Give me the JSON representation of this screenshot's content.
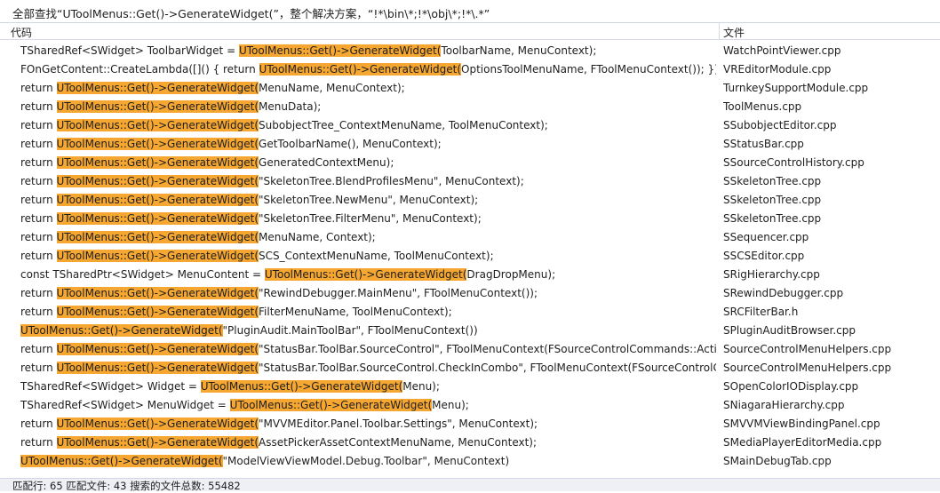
{
  "title": "全部查找“UToolMenus::Get()->GenerateWidget(”，整个解决方案，“!*\\bin\\*;!*\\obj\\*;!*\\.*”",
  "columns": {
    "code": "代码",
    "file": "文件"
  },
  "sort_icon": "chevron-up-icon",
  "highlight_color": "#f5a732",
  "rows": [
    {
      "pre": "TSharedRef<SWidget> ToolbarWidget = ",
      "match": "UToolMenus::Get()->GenerateWidget(",
      "post": "ToolbarName, MenuContext);",
      "file": "WatchPointViewer.cpp"
    },
    {
      "pre": "FOnGetContent::CreateLambda([]() { return ",
      "match": "UToolMenus::Get()->GenerateWidget(",
      "post": "OptionsToolMenuName, FToolMenuContext()); }),",
      "file": "VREditorModule.cpp"
    },
    {
      "pre": "return ",
      "match": "UToolMenus::Get()->GenerateWidget(",
      "post": "MenuName, MenuContext);",
      "file": "TurnkeySupportModule.cpp"
    },
    {
      "pre": "return ",
      "match": "UToolMenus::Get()->GenerateWidget(",
      "post": "MenuData);",
      "file": "ToolMenus.cpp"
    },
    {
      "pre": "return ",
      "match": "UToolMenus::Get()->GenerateWidget(",
      "post": "SubobjectTree_ContextMenuName, ToolMenuContext);",
      "file": "SSubobjectEditor.cpp"
    },
    {
      "pre": "return ",
      "match": "UToolMenus::Get()->GenerateWidget(",
      "post": "GetToolbarName(), MenuContext);",
      "file": "SStatusBar.cpp"
    },
    {
      "pre": "return ",
      "match": "UToolMenus::Get()->GenerateWidget(",
      "post": "GeneratedContextMenu);",
      "file": "SSourceControlHistory.cpp"
    },
    {
      "pre": "return ",
      "match": "UToolMenus::Get()->GenerateWidget(",
      "post": "\"SkeletonTree.BlendProfilesMenu\", MenuContext);",
      "file": "SSkeletonTree.cpp"
    },
    {
      "pre": "return ",
      "match": "UToolMenus::Get()->GenerateWidget(",
      "post": "\"SkeletonTree.NewMenu\", MenuContext);",
      "file": "SSkeletonTree.cpp"
    },
    {
      "pre": "return ",
      "match": "UToolMenus::Get()->GenerateWidget(",
      "post": "\"SkeletonTree.FilterMenu\", MenuContext);",
      "file": "SSkeletonTree.cpp"
    },
    {
      "pre": "return ",
      "match": "UToolMenus::Get()->GenerateWidget(",
      "post": "MenuName, Context);",
      "file": "SSequencer.cpp"
    },
    {
      "pre": "return ",
      "match": "UToolMenus::Get()->GenerateWidget(",
      "post": "SCS_ContextMenuName, ToolMenuContext);",
      "file": "SSCSEditor.cpp"
    },
    {
      "pre": "const TSharedPtr<SWidget> MenuContent = ",
      "match": "UToolMenus::Get()->GenerateWidget(",
      "post": "DragDropMenu);",
      "file": "SRigHierarchy.cpp"
    },
    {
      "pre": "return ",
      "match": "UToolMenus::Get()->GenerateWidget(",
      "post": "\"RewindDebugger.MainMenu\", FToolMenuContext());",
      "file": "SRewindDebugger.cpp"
    },
    {
      "pre": "return ",
      "match": "UToolMenus::Get()->GenerateWidget(",
      "post": "FilterMenuName, ToolMenuContext);",
      "file": "SRCFilterBar.h"
    },
    {
      "pre": "",
      "match": "UToolMenus::Get()->GenerateWidget(",
      "post": "\"PluginAudit.MainToolBar\", FToolMenuContext())",
      "file": "SPluginAuditBrowser.cpp"
    },
    {
      "pre": "return ",
      "match": "UToolMenus::Get()->GenerateWidget(",
      "post": "\"StatusBar.ToolBar.SourceControl\", FToolMenuContext(FSourceControlCommands::Action…",
      "file": "SourceControlMenuHelpers.cpp"
    },
    {
      "pre": "return ",
      "match": "UToolMenus::Get()->GenerateWidget(",
      "post": "\"StatusBar.ToolBar.SourceControl.CheckInCombo\", FToolMenuContext(FSourceControlCo…",
      "file": "SourceControlMenuHelpers.cpp"
    },
    {
      "pre": "TSharedRef<SWidget> Widget = ",
      "match": "UToolMenus::Get()->GenerateWidget(",
      "post": "Menu);",
      "file": "SOpenColorIODisplay.cpp"
    },
    {
      "pre": "TSharedRef<SWidget> MenuWidget = ",
      "match": "UToolMenus::Get()->GenerateWidget(",
      "post": "Menu);",
      "file": "SNiagaraHierarchy.cpp"
    },
    {
      "pre": "return ",
      "match": "UToolMenus::Get()->GenerateWidget(",
      "post": "\"MVVMEditor.Panel.Toolbar.Settings\", MenuContext);",
      "file": "SMVVMViewBindingPanel.cpp"
    },
    {
      "pre": "return ",
      "match": "UToolMenus::Get()->GenerateWidget(",
      "post": "AssetPickerAssetContextMenuName, MenuContext);",
      "file": "SMediaPlayerEditorMedia.cpp"
    },
    {
      "pre": "",
      "match": "UToolMenus::Get()->GenerateWidget(",
      "post": "\"ModelViewViewModel.Debug.Toolbar\", MenuContext)",
      "file": "SMainDebugTab.cpp"
    }
  ],
  "status": "匹配行: 65 匹配文件: 43 搜索的文件总数: 55482"
}
